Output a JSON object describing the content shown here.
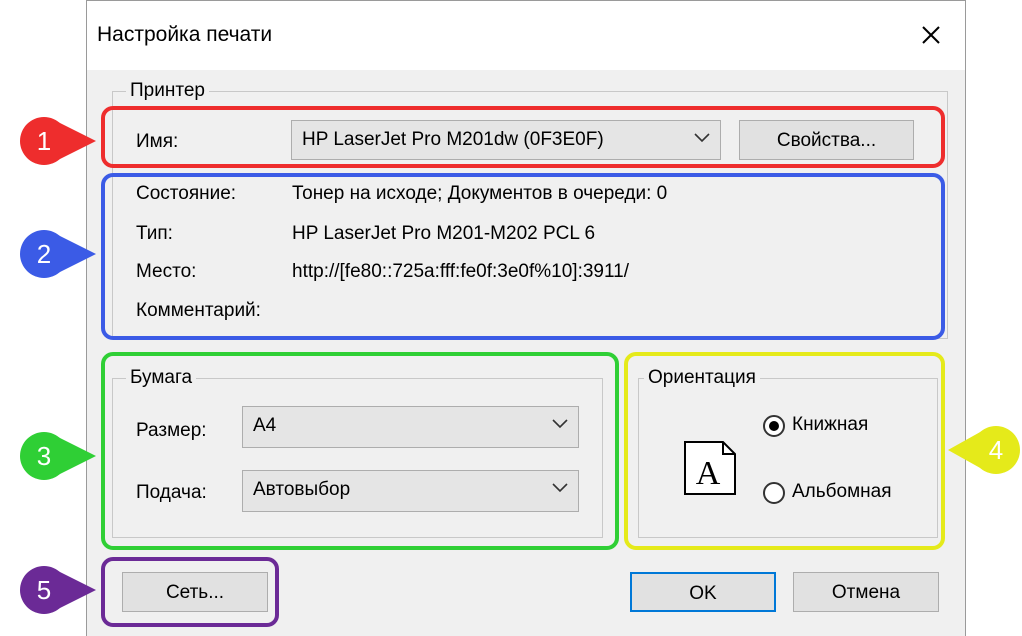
{
  "window": {
    "title": "Настройка печати"
  },
  "printer": {
    "group_label": "Принтер",
    "name_label": "Имя:",
    "name_value": "HP LaserJet Pro M201dw (0F3E0F)",
    "properties_button": "Свойства...",
    "status_label": "Состояние:",
    "status_value": "Тонер на исходе; Документов в очереди: 0",
    "type_label": "Тип:",
    "type_value": "HP LaserJet Pro M201-M202 PCL 6",
    "location_label": "Место:",
    "location_value": "http://[fe80::725a:fff:fe0f:3e0f%10]:3911/",
    "comment_label": "Комментарий:",
    "comment_value": ""
  },
  "paper": {
    "group_label": "Бумага",
    "size_label": "Размер:",
    "size_value": "A4",
    "source_label": "Подача:",
    "source_value": "Автовыбор"
  },
  "orientation": {
    "group_label": "Ориентация",
    "portrait_label": "Книжная",
    "landscape_label": "Альбомная",
    "selected": "portrait",
    "preview_letter": "A"
  },
  "buttons": {
    "network": "Сеть...",
    "ok": "OK",
    "cancel": "Отмена"
  },
  "markers": [
    {
      "num": "1",
      "color": "#ee2d2d"
    },
    {
      "num": "2",
      "color": "#3b5be6"
    },
    {
      "num": "3",
      "color": "#2fcf35"
    },
    {
      "num": "4",
      "color": "#e5ea1a"
    },
    {
      "num": "5",
      "color": "#6b2a96"
    }
  ]
}
